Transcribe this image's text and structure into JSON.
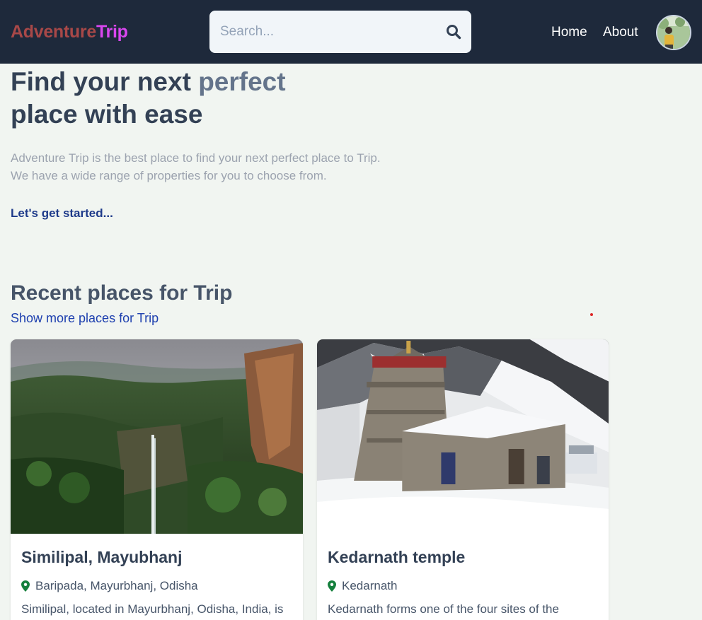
{
  "nav": {
    "logo_part1": "Adventure",
    "logo_part2": "Trip",
    "search_placeholder": "Search...",
    "links": [
      "Home",
      "About"
    ]
  },
  "hero": {
    "title_prefix": "Find your next ",
    "title_accent": "perfect",
    "title_suffix": "place with ease",
    "desc_line1": "Adventure Trip is the best place to find your next perfect place to Trip.",
    "desc_line2": "We have a wide range of properties for you to choose from.",
    "cta": "Let's get started..."
  },
  "recent": {
    "title": "Recent places for Trip",
    "show_more": "Show more places for Trip"
  },
  "cards": [
    {
      "title": "Similipal, Mayubhanj",
      "location": "Baripada, Mayurbhanj, Odisha",
      "description": "Similipal, located in Mayurbhanj, Odisha, India, is",
      "image_icon": "waterfall-image"
    },
    {
      "title": "Kedarnath temple",
      "location": "Kedarnath",
      "description": "Kedarnath forms one of the four sites of the",
      "image_icon": "temple-image"
    }
  ],
  "colors": {
    "navbar": "#1e293b",
    "logo_part1": "#a84848",
    "logo_part2": "#d946ef",
    "cta": "#1e3a8a",
    "link": "#1e40af",
    "location_pin": "#15803d"
  }
}
